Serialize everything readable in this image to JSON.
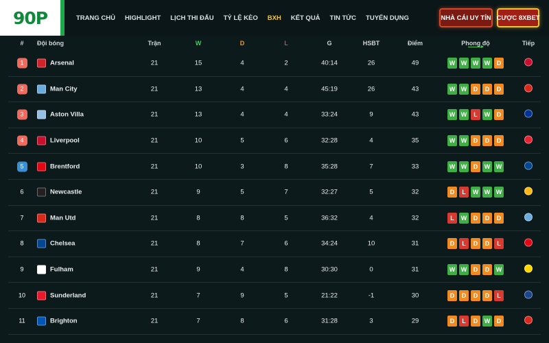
{
  "header": {
    "logo": "90P",
    "nav": [
      "TRANG CHỦ",
      "HIGHLIGHT",
      "LỊCH THI ĐẤU",
      "TỶ LỆ KÈO",
      "BXH",
      "KẾT QUẢ",
      "TIN TỨC",
      "TUYỂN DỤNG"
    ],
    "active_nav": "BXH",
    "btn_uytin": "NHÀ CÁI UY TÍN",
    "btn_cuoc": "CƯỢC 8XBET"
  },
  "table": {
    "columns": {
      "rank": "#",
      "team": "Đội bóng",
      "played": "Trận",
      "won": "W",
      "drawn": "D",
      "lost": "L",
      "goals": "G",
      "gd": "HSBT",
      "points": "Điểm",
      "form": "Phong độ",
      "next": "Tiếp"
    },
    "colors": {
      "rank_top4": "#f06a5e",
      "rank_5": "#3b8fd8",
      "win": "#3fae45",
      "draw": "#f08a21",
      "loss": "#d63a30"
    },
    "rows": [
      {
        "rank": "1",
        "team": "Arsenal",
        "played": "21",
        "won": "15",
        "drawn": "4",
        "lost": "2",
        "goals": "40:14",
        "gd": "26",
        "points": "49",
        "form": [
          "W",
          "W",
          "W",
          "W",
          "D"
        ],
        "crest": "#d3232a",
        "next_crest": "#c8102e"
      },
      {
        "rank": "2",
        "team": "Man City",
        "played": "21",
        "won": "13",
        "drawn": "4",
        "lost": "4",
        "goals": "45:19",
        "gd": "26",
        "points": "43",
        "form": [
          "W",
          "W",
          "D",
          "D",
          "D"
        ],
        "crest": "#6cabdd",
        "next_crest": "#da291c"
      },
      {
        "rank": "3",
        "team": "Aston Villa",
        "played": "21",
        "won": "13",
        "drawn": "4",
        "lost": "4",
        "goals": "33:24",
        "gd": "9",
        "points": "43",
        "form": [
          "W",
          "W",
          "L",
          "W",
          "D"
        ],
        "crest": "#95bfe5",
        "next_crest": "#003399"
      },
      {
        "rank": "4",
        "team": "Liverpool",
        "played": "21",
        "won": "10",
        "drawn": "5",
        "lost": "6",
        "goals": "32:28",
        "gd": "4",
        "points": "35",
        "form": [
          "W",
          "W",
          "D",
          "D",
          "D"
        ],
        "crest": "#c8102e",
        "next_crest": "#e62333"
      },
      {
        "rank": "5",
        "team": "Brentford",
        "played": "21",
        "won": "10",
        "drawn": "3",
        "lost": "8",
        "goals": "35:28",
        "gd": "7",
        "points": "33",
        "form": [
          "W",
          "W",
          "D",
          "W",
          "W"
        ],
        "crest": "#e30613",
        "next_crest": "#034694"
      },
      {
        "rank": "6",
        "team": "Newcastle",
        "played": "21",
        "won": "9",
        "drawn": "5",
        "lost": "7",
        "goals": "32:27",
        "gd": "5",
        "points": "32",
        "form": [
          "D",
          "L",
          "W",
          "W",
          "W"
        ],
        "crest": "#241f20",
        "next_crest": "#fdb913"
      },
      {
        "rank": "7",
        "team": "Man Utd",
        "played": "21",
        "won": "8",
        "drawn": "8",
        "lost": "5",
        "goals": "36:32",
        "gd": "4",
        "points": "32",
        "form": [
          "L",
          "W",
          "D",
          "D",
          "D"
        ],
        "crest": "#da291c",
        "next_crest": "#6cabdd"
      },
      {
        "rank": "8",
        "team": "Chelsea",
        "played": "21",
        "won": "8",
        "drawn": "7",
        "lost": "6",
        "goals": "34:24",
        "gd": "10",
        "points": "31",
        "form": [
          "D",
          "L",
          "D",
          "D",
          "L"
        ],
        "crest": "#034694",
        "next_crest": "#e30613"
      },
      {
        "rank": "9",
        "team": "Fulham",
        "played": "21",
        "won": "9",
        "drawn": "4",
        "lost": "8",
        "goals": "30:30",
        "gd": "0",
        "points": "31",
        "form": [
          "W",
          "W",
          "D",
          "D",
          "W"
        ],
        "crest": "#ffffff",
        "next_crest": "#ffd700"
      },
      {
        "rank": "10",
        "team": "Sunderland",
        "played": "21",
        "won": "7",
        "drawn": "9",
        "lost": "5",
        "goals": "21:22",
        "gd": "-1",
        "points": "30",
        "form": [
          "D",
          "D",
          "D",
          "D",
          "L"
        ],
        "crest": "#eb172b",
        "next_crest": "#1b458f"
      },
      {
        "rank": "11",
        "team": "Brighton",
        "played": "21",
        "won": "7",
        "drawn": "8",
        "lost": "6",
        "goals": "31:28",
        "gd": "3",
        "points": "29",
        "form": [
          "D",
          "L",
          "D",
          "W",
          "D"
        ],
        "crest": "#0057b8",
        "next_crest": "#da291c"
      }
    ]
  }
}
